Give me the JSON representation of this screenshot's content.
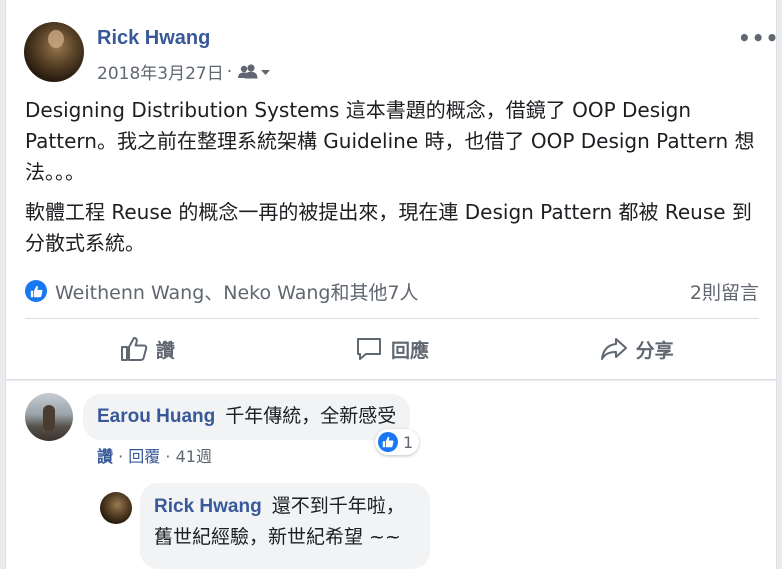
{
  "post": {
    "author": "Rick Hwang",
    "date": "2018年3月27日",
    "separator": "·",
    "more_label": "•••",
    "paragraphs": [
      "Designing Distribution Systems 這本書題的概念，借鏡了 OOP Design Pattern。我之前在整理系統架構 Guideline 時，也借了 OOP Design Pattern 想法。。。",
      "軟體工程 Reuse 的概念一再的被提出來，現在連 Design Pattern 都被 Reuse 到分散式系統。"
    ],
    "reactions_text": "Weithenn Wang、Neko Wang和其他7人",
    "comment_count": "2則留言"
  },
  "actions": {
    "like": "讚",
    "comment": "回應",
    "share": "分享"
  },
  "comments": [
    {
      "author": "Earou Huang",
      "text": "千年傳統，全新感受",
      "reaction_count": "1",
      "like_label": "讚",
      "reply_label": "回覆",
      "time": "41週",
      "sep": "·"
    }
  ],
  "reply": {
    "author": "Rick Hwang",
    "line1": "還不到千年啦，",
    "line2": "舊世紀經驗，新世紀希望 ~~"
  },
  "colors": {
    "link": "#385898",
    "like_blue": "#1877f2",
    "muted": "#606770"
  },
  "icons": [
    "people-icon",
    "caret-down-icon",
    "like-icon",
    "thumbs-up-outline-icon",
    "comment-bubble-icon",
    "share-arrow-icon"
  ]
}
